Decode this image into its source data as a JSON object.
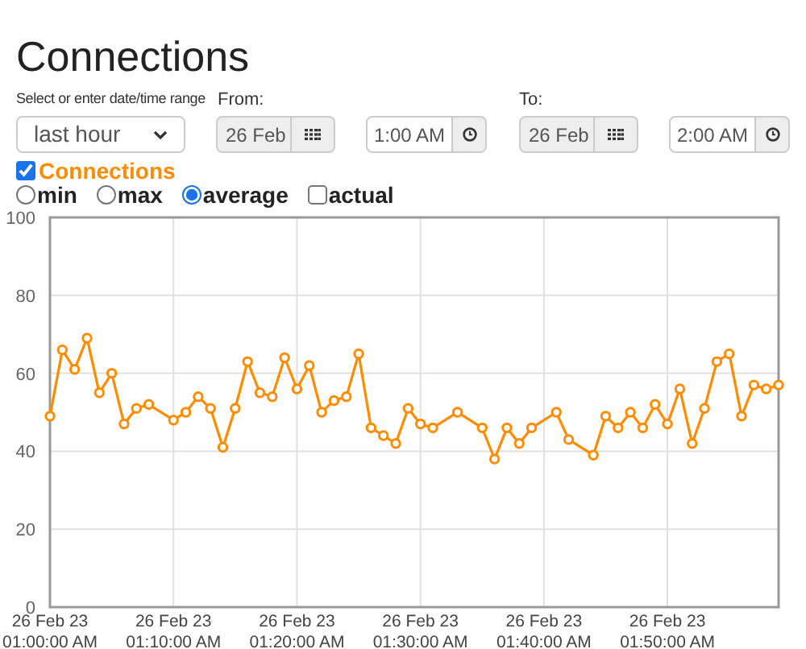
{
  "page_title": "Connections",
  "range": {
    "label": "Select or enter date/time range",
    "value": "last hour"
  },
  "from": {
    "label": "From:",
    "date": "26 Feb",
    "time": "1:00 AM"
  },
  "to": {
    "label": "To:",
    "date": "26 Feb",
    "time": "2:00 AM"
  },
  "series_toggle": {
    "checked": true,
    "color": "#ff8c00"
  },
  "modes": [
    {
      "label": "min",
      "kind": "radio",
      "selected": false
    },
    {
      "label": "max",
      "kind": "radio",
      "selected": false
    },
    {
      "label": "average",
      "kind": "radio",
      "selected": true
    },
    {
      "label": "actual",
      "kind": "checkbox",
      "checked": false
    }
  ],
  "chart": {
    "chart_data": {
      "type": "line",
      "grid": true,
      "ylim": [
        0,
        100
      ],
      "yticks": [
        0,
        20,
        40,
        60,
        80,
        100
      ],
      "categories": [
        "26 Feb 23\n01:00:00 AM",
        null,
        null,
        null,
        null,
        null,
        null,
        null,
        null,
        null,
        "26 Feb 23\n01:10:00 AM",
        null,
        null,
        null,
        null,
        null,
        null,
        null,
        null,
        null,
        "26 Feb 23\n01:20:00 AM",
        null,
        null,
        null,
        null,
        null,
        null,
        null,
        null,
        null,
        "26 Feb 23\n01:30:00 AM",
        null,
        null,
        null,
        null,
        null,
        null,
        null,
        null,
        null,
        "26 Feb 23\n01:40:00 AM",
        null,
        null,
        null,
        null,
        null,
        null,
        null,
        null,
        null,
        "26 Feb 23\n01:50:00 AM",
        null,
        null,
        null,
        null,
        null,
        null,
        null,
        null,
        null
      ],
      "series": [
        {
          "name": "Connections",
          "color": "#ff8c00",
          "marker": "circle",
          "values": [
            49,
            66,
            61,
            69,
            55,
            60,
            47,
            51,
            52,
            null,
            48,
            50,
            54,
            51,
            41,
            51,
            63,
            55,
            54,
            64,
            56,
            62,
            50,
            53,
            54,
            65,
            46,
            44,
            42,
            51,
            47,
            46,
            null,
            50,
            null,
            46,
            38,
            46,
            42,
            46,
            null,
            50,
            43,
            null,
            39,
            49,
            46,
            50,
            46,
            52,
            47,
            56,
            42,
            51,
            63,
            65,
            49,
            57,
            56,
            57
          ]
        }
      ]
    }
  }
}
